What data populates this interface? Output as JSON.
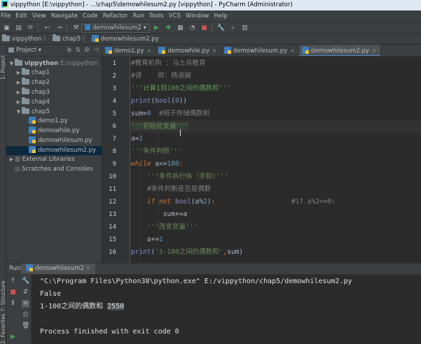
{
  "title_bar": {
    "text": "vippython [E:\\vippython] - ...\\chap5\\demowhilesum2.py [vippython] - PyCharm (Administrator)"
  },
  "menu": {
    "items": [
      "File",
      "Edit",
      "View",
      "Navigate",
      "Code",
      "Refactor",
      "Run",
      "Tools",
      "VCS",
      "Window",
      "Help"
    ]
  },
  "toolbar": {
    "run_config": "demowhilesum2"
  },
  "navbar": {
    "crumbs": [
      "vippython",
      "chap5",
      "demowhilesum2.py"
    ]
  },
  "side_tabs": {
    "project": "1: Project",
    "structure": "7: Structure",
    "favorites": "2: Favorites"
  },
  "project_panel": {
    "header": "Project",
    "tree": [
      {
        "label": "vippython",
        "path": "E:\\vippython",
        "type": "folder",
        "expanded": true
      },
      {
        "label": "chap1",
        "type": "folder"
      },
      {
        "label": "chap2",
        "type": "folder"
      },
      {
        "label": "chap3",
        "type": "folder"
      },
      {
        "label": "chap4",
        "type": "folder"
      },
      {
        "label": "chap5",
        "type": "folder",
        "expanded": true
      },
      {
        "label": "demo1.py",
        "type": "file"
      },
      {
        "label": "demowhile.py",
        "type": "file"
      },
      {
        "label": "demowhilesum.py",
        "type": "file"
      },
      {
        "label": "demowhilesum2.py",
        "type": "file",
        "selected": true
      },
      {
        "label": "External Libraries",
        "type": "lib"
      },
      {
        "label": "Scratches and Consoles",
        "type": "scratch"
      }
    ]
  },
  "editor": {
    "tabs": [
      "demo1.py",
      "demowhile.py",
      "demowhilesum.py",
      "demowhilesum2.py"
    ],
    "active_tab": "demowhilesum2.py",
    "current_line": 6,
    "lines": [
      {
        "n": "1",
        "text": "#教育机构 ：马士兵教育"
      },
      {
        "n": "2",
        "text": "#讲    师：杨淑娟"
      },
      {
        "n": "3",
        "text": "'''计算1到100之间的偶数和'''"
      },
      {
        "n": "4",
        "text": "print(bool(0))"
      },
      {
        "n": "5",
        "text": "sum=0  #用于存储偶数和"
      },
      {
        "n": "6",
        "text": "'''初始化变量'''"
      },
      {
        "n": "7",
        "text": "a=1"
      },
      {
        "n": "8",
        "text": "'''条件判断'''"
      },
      {
        "n": "9",
        "text": "while a<=100:"
      },
      {
        "n": "10",
        "text": "    '''条件执行体（求和)'''"
      },
      {
        "n": "11",
        "text": "    #条件判断是否是偶数"
      },
      {
        "n": "12",
        "text": "    if not bool(a%2):                   #if a%2==0:"
      },
      {
        "n": "13",
        "text": "        sum+=a"
      },
      {
        "n": "14",
        "text": "    '''改变变量'''"
      },
      {
        "n": "15",
        "text": "    a+=1"
      },
      {
        "n": "16",
        "text": "print('1-100之间的偶数和',sum)"
      }
    ]
  },
  "run_panel": {
    "label": "Run:",
    "tab": "demowhilesum2",
    "console": {
      "command": "\"C:\\Program Files\\Python38\\python.exe\" E:/vippython/chap5/demowhilesum2.py",
      "out1": "False",
      "out2_prefix": "1-100之间的偶数和 ",
      "out2_value": "2550",
      "exit": "Process finished with exit code 0"
    }
  },
  "colors": {
    "background": "#2b2b2b",
    "panel": "#3c3f41",
    "keyword": "#cc7832",
    "string": "#6a8759",
    "comment": "#808080",
    "number": "#6897bb",
    "selection": "#0d293e"
  }
}
